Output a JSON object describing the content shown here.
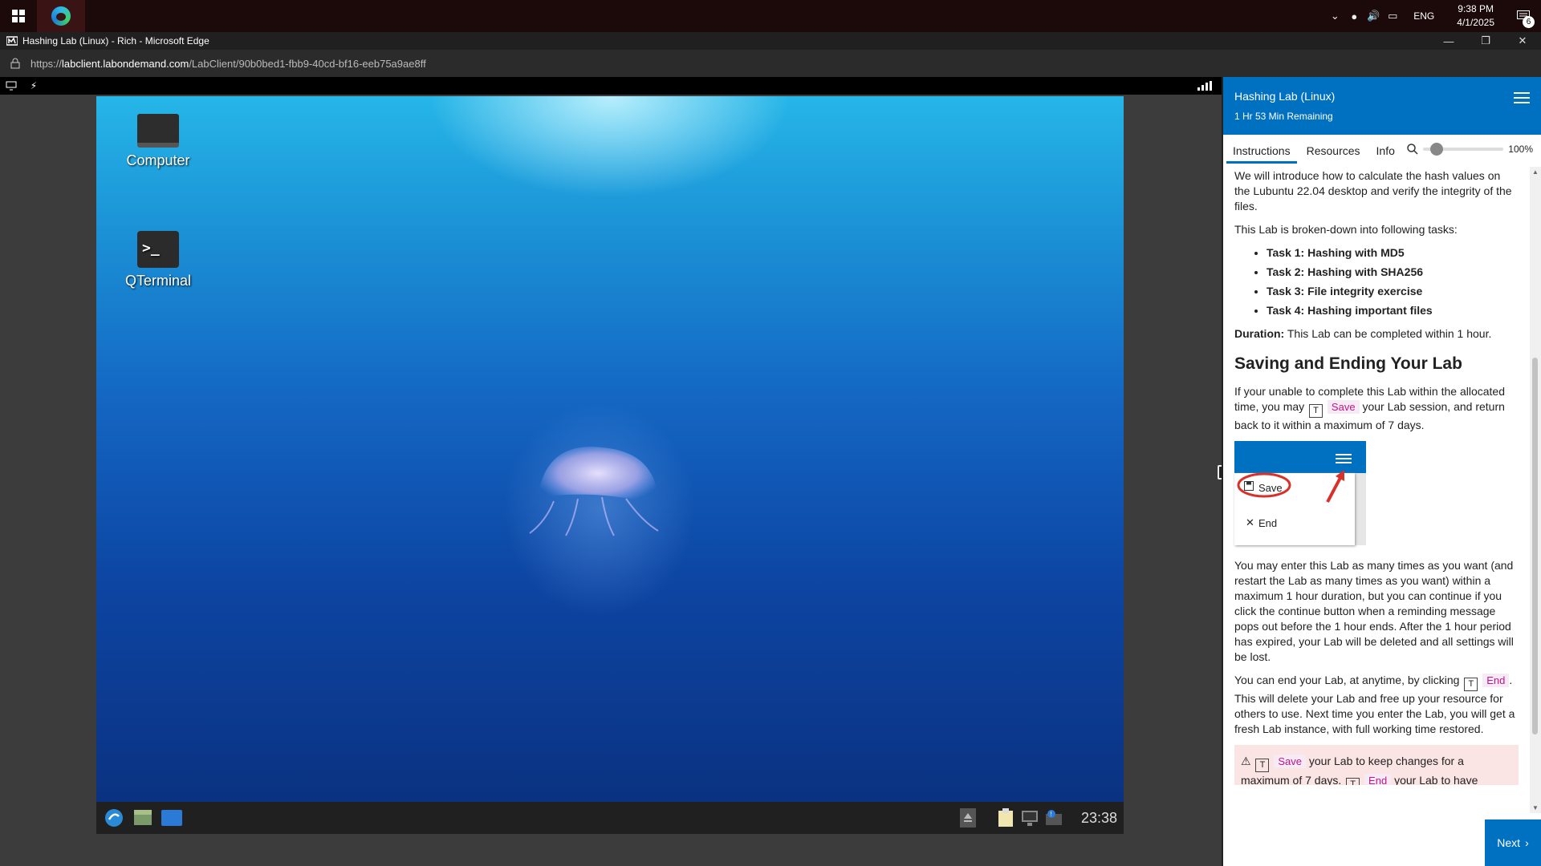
{
  "taskbar": {
    "language": "ENG",
    "time": "9:38 PM",
    "date": "4/1/2025",
    "notification_count": "6"
  },
  "window": {
    "title": "Hashing Lab (Linux) - Rich - Microsoft Edge",
    "url_prefix": "https://",
    "url_host": "labclient.labondemand.com",
    "url_path": "/LabClient/90b0bed1-fbb9-40cd-bf16-eeb75a9ae8ff"
  },
  "vm": {
    "desktop_icons": [
      {
        "label": "Computer",
        "icon": "monitor-icon"
      },
      {
        "label": "QTerminal",
        "icon": "terminal-icon"
      }
    ],
    "clock": "23:38"
  },
  "lab": {
    "title": "Hashing Lab (Linux)",
    "time_remaining": "1 Hr 53 Min Remaining",
    "tabs": [
      "Instructions",
      "Resources",
      "Info"
    ],
    "zoom": "100%",
    "zoom_level": 0.1,
    "intro": "We will introduce how to calculate the hash values on the Lubuntu 22.04 desktop and verify the integrity of the files.",
    "breakdown": "This Lab is broken-down into following tasks:",
    "tasks": [
      "Task 1: Hashing with MD5",
      "Task 2: Hashing with SHA256",
      "Task 3: File integrity exercise",
      "Task 4: Hashing important files"
    ],
    "duration_label": "Duration:",
    "duration_text": " This Lab can be completed within 1 hour.",
    "heading": "Saving and Ending Your Lab",
    "save_para_1": "If your unable to complete this Lab within the allocated time, you may",
    "save_label": "Save",
    "save_para_2": " your Lab session, and return back to it within a maximum of 7 days.",
    "menu_save": "Save",
    "menu_end": "End",
    "enter_para": "You may enter this Lab as many times as you want (and restart the Lab as many times as you want) within a maximum 1 hour duration, but you can continue if you click the continue button when a reminding message pops out before the 1 hour ends. After the 1 hour period has expired, your Lab will be deleted and all settings will be lost.",
    "end_para_1": "You can end your Lab, at anytime, by clicking",
    "end_label": "End",
    "end_para_2": ". This will delete your Lab and free up your resource for others to use. Next time you enter the Lab, you will get a fresh Lab instance, with full working time restored.",
    "warning_1": " your Lab to keep changes for a maximum of 7 days.",
    "warning_2": " your Lab to have",
    "t_glyph": "T",
    "next": "Next"
  }
}
